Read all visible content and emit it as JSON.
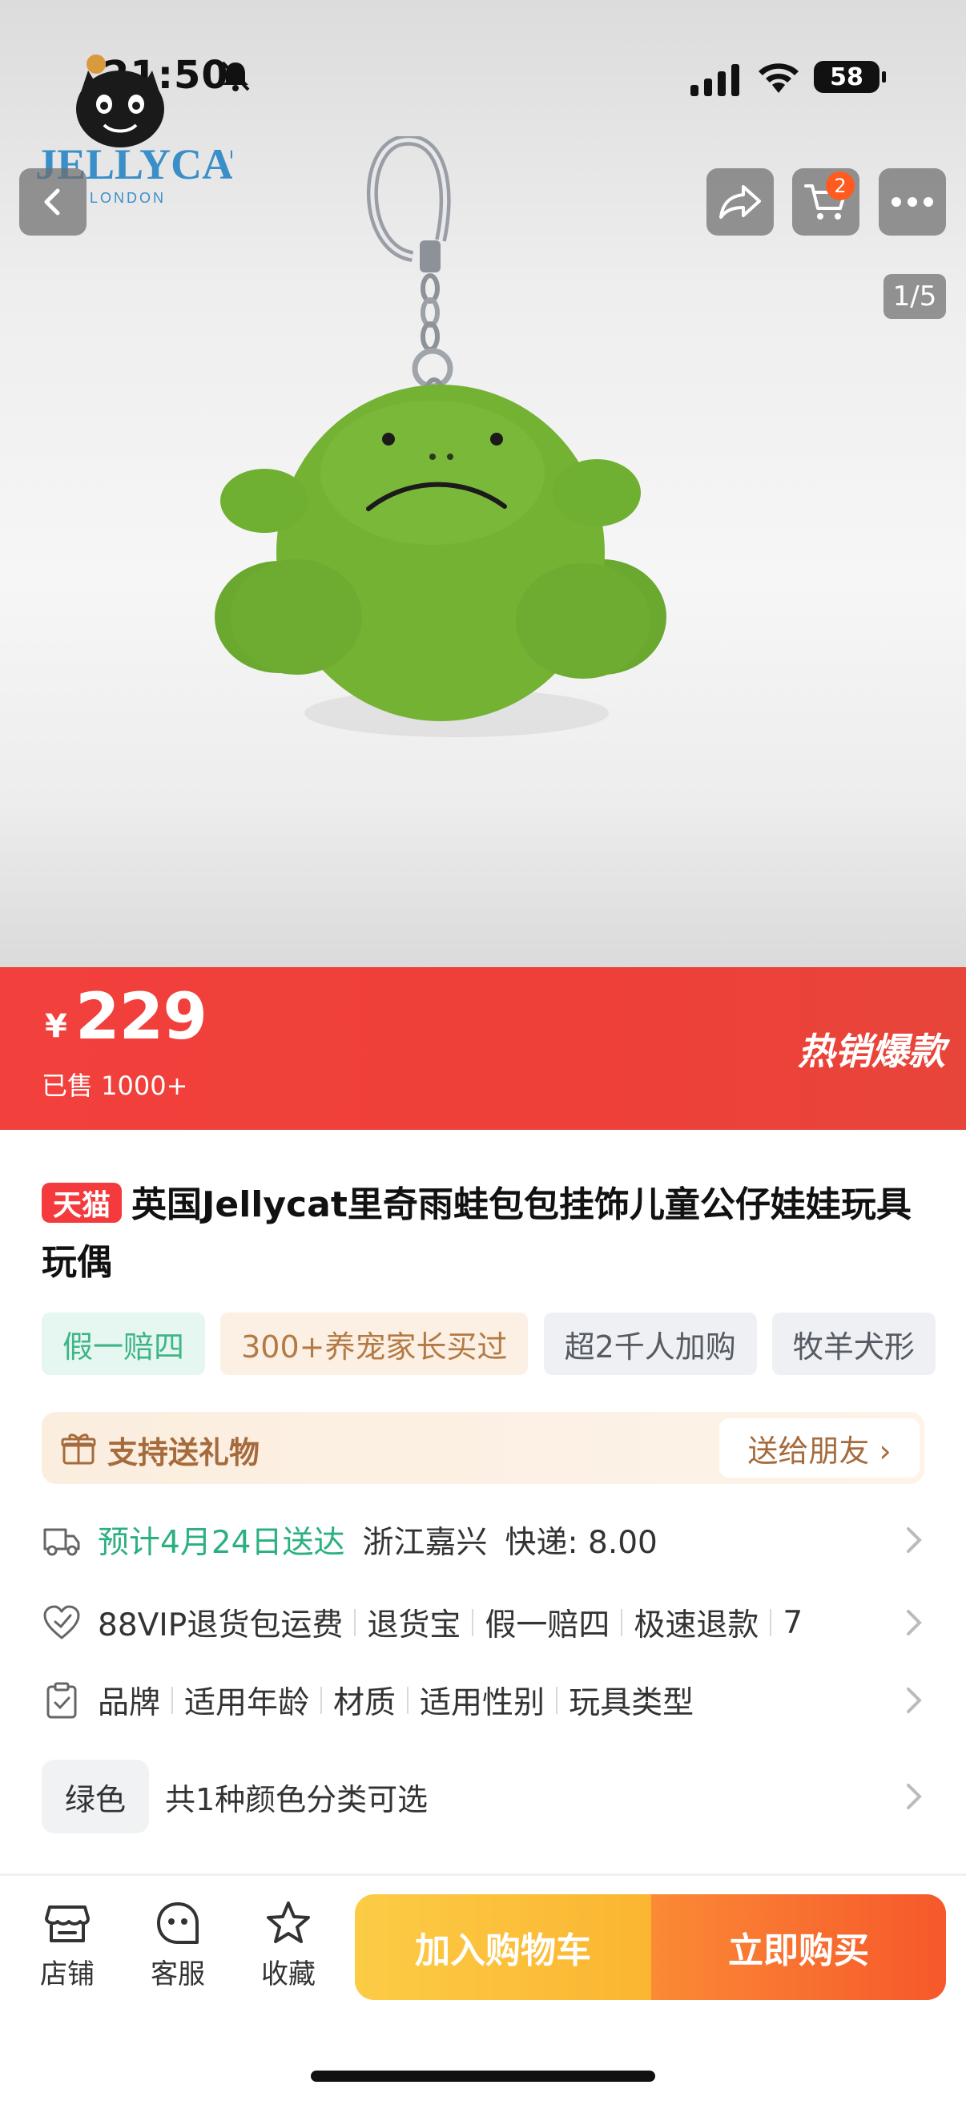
{
  "status_bar": {
    "time": "21:50",
    "battery": "58"
  },
  "nav": {
    "cart_count": "2",
    "page_indicator": "1/5"
  },
  "price": {
    "currency": "¥",
    "amount": "229",
    "sold": "已售 1000+",
    "tag": "热销爆款"
  },
  "product": {
    "badge": "天猫",
    "title": "英国Jellycat里奇雨蛙包包挂饰儿童公仔娃娃玩具玩偶"
  },
  "tags": [
    "假一赔四",
    "300+养宠家长买过",
    "超2千人加购",
    "牧羊犬形"
  ],
  "gift": {
    "label": "支持送礼物",
    "button": "送给朋友 ›"
  },
  "delivery": {
    "eta": "预计4月24日送达",
    "origin": "浙江嘉兴",
    "shipping": "快递: 8.00"
  },
  "services": [
    "88VIP退货包运费",
    "退货宝",
    "假一赔四",
    "极速退款",
    "7"
  ],
  "params": [
    "品牌",
    "适用年龄",
    "材质",
    "适用性别",
    "玩具类型"
  ],
  "color": {
    "chip": "绿色",
    "text": "共1种颜色分类可选"
  },
  "bottom": {
    "store": "店铺",
    "service": "客服",
    "favorite": "收藏",
    "add_cart": "加入购物车",
    "buy_now": "立即购买"
  },
  "colors": {
    "accent_red": "#f2403c",
    "tmall_red": "#f43a3d",
    "green": "#2bb07f",
    "cart_yellow": "#fbb531",
    "buy_orange": "#f6582b"
  }
}
